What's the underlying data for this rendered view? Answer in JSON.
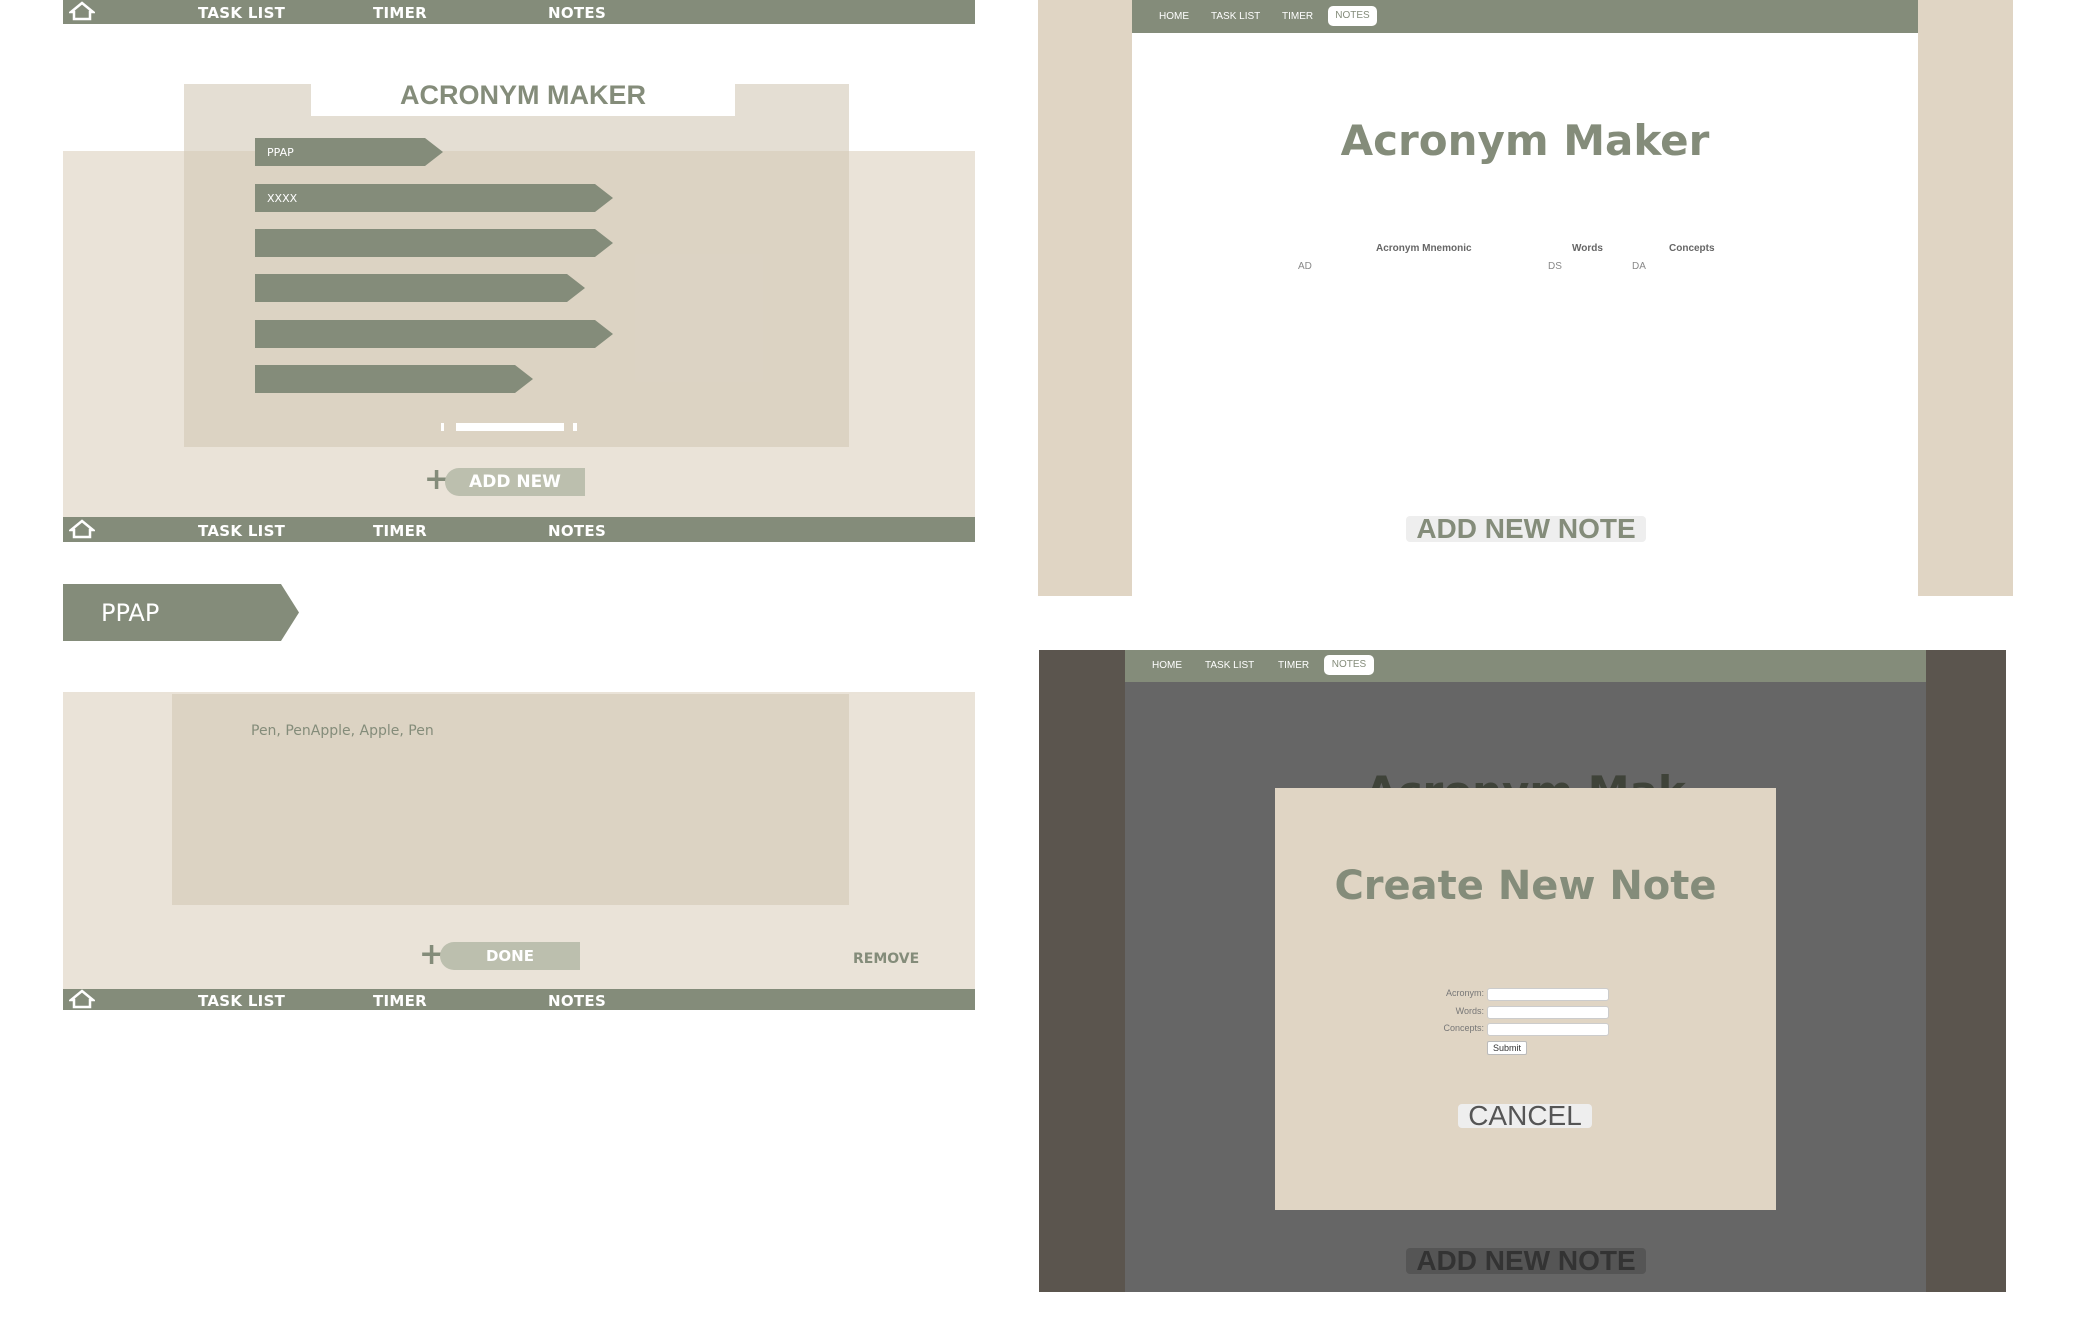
{
  "colors": {
    "sage": "#848c7a",
    "beige_light": "#eae3d8",
    "beige_mid": "#dcd3c3",
    "panel_beige": "#e0d5c4",
    "overlay_gray": "#666666",
    "overlay_side": "#5b554e",
    "white": "#ffffff"
  },
  "nav": {
    "task_list": "TASK LIST",
    "timer": "TIMER",
    "notes": "NOTES",
    "home_icon": "home-icon"
  },
  "mock1": {
    "title": "ACRONYM MAKER",
    "items": [
      "PPAP",
      "XXXX",
      "",
      "",
      "",
      ""
    ],
    "add_new": "ADD NEW"
  },
  "mock2": {
    "tag": "PPAP",
    "note_text": "Pen, PenApple, Apple, Pen",
    "done": "DONE",
    "remove": "REMOVE"
  },
  "web_nav": {
    "home": "HOME",
    "task_list": "TASK LIST",
    "timer": "TIMER",
    "notes": "NOTES"
  },
  "web1": {
    "title": "Acronym Maker",
    "headers": [
      "Acronym Mnemonic",
      "Words",
      "Concepts"
    ],
    "row": [
      "AD",
      "DS",
      "DA"
    ],
    "add_note": "ADD NEW NOTE"
  },
  "web2": {
    "bg_title_partial": "Acronym Mak",
    "modal_title": "Create New Note",
    "form": {
      "acronym_label": "Acronym:",
      "words_label": "Words:",
      "concepts_label": "Concepts:",
      "acronym_value": "",
      "words_value": "",
      "concepts_value": "",
      "submit": "Submit"
    },
    "cancel": "CANCEL",
    "add_note": "ADD NEW NOTE"
  }
}
